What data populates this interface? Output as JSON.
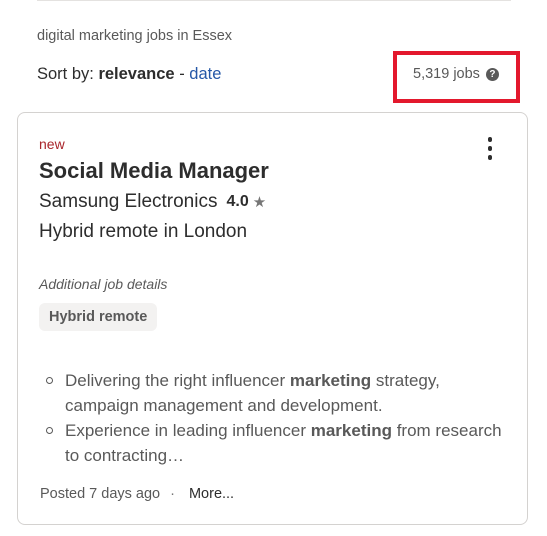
{
  "search_context": "digital marketing jobs in Essex",
  "sort": {
    "label": "Sort by:",
    "current": "relevance",
    "separator": "-",
    "alternate": "date"
  },
  "job_count": {
    "text": "5,319 jobs",
    "help_icon": "?"
  },
  "highlight_color": "#e3182d",
  "job": {
    "badge": "new",
    "title": "Social Media Manager",
    "company": "Samsung Electronics",
    "rating": "4.0",
    "rating_icon": "★",
    "location": "Hybrid remote in London",
    "additional_label": "Additional job details",
    "tags": [
      "Hybrid remote"
    ],
    "snippet": [
      {
        "before": "Delivering the right influencer ",
        "bold": "marketing",
        "after": " strategy, campaign management and development."
      },
      {
        "before": "Experience in leading influencer ",
        "bold": "marketing",
        "after": " from research to contracting…"
      }
    ],
    "posted": "Posted 7 days ago",
    "footer_sep": "·",
    "more_link": "More..."
  }
}
